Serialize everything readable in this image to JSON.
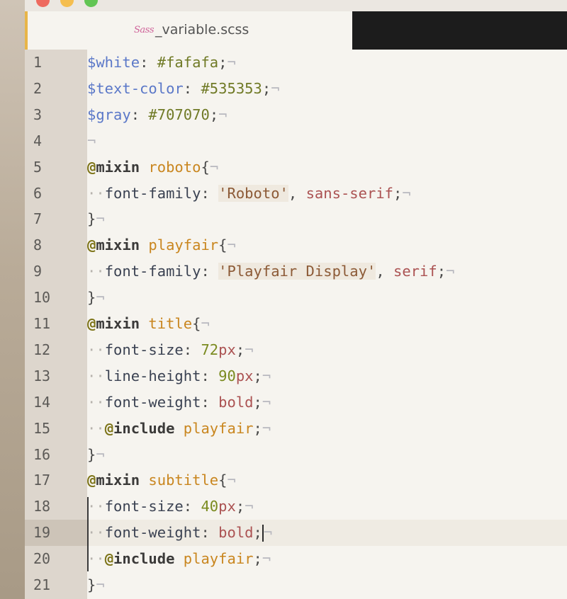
{
  "tab": {
    "filename": "_variable.scss",
    "icon": "sass-icon",
    "accent": "#e8b548"
  },
  "colors": {
    "gutter": "#ddd6cd",
    "editor_bg": "#f6f4ef",
    "tabbar_bg": "#1c1c1c"
  },
  "editor": {
    "current_line": 19
  },
  "lines": [
    {
      "n": "1",
      "indent": "",
      "parts": [
        [
          "var",
          "$white"
        ],
        [
          "punct",
          ": "
        ],
        [
          "hex",
          "#fafafa"
        ],
        [
          "punct",
          ";"
        ],
        [
          "inv",
          "¬"
        ]
      ]
    },
    {
      "n": "2",
      "indent": "",
      "parts": [
        [
          "var",
          "$text-color"
        ],
        [
          "punct",
          ": "
        ],
        [
          "hex",
          "#535353"
        ],
        [
          "punct",
          ";"
        ],
        [
          "inv",
          "¬"
        ]
      ]
    },
    {
      "n": "3",
      "indent": "",
      "parts": [
        [
          "var",
          "$gray"
        ],
        [
          "punct",
          ": "
        ],
        [
          "hex",
          "#707070"
        ],
        [
          "punct",
          ";"
        ],
        [
          "inv",
          "¬"
        ]
      ]
    },
    {
      "n": "4",
      "indent": "",
      "parts": [
        [
          "inv",
          "¬"
        ]
      ]
    },
    {
      "n": "5",
      "indent": "",
      "parts": [
        [
          "at",
          "@"
        ],
        [
          "kw",
          "mixin"
        ],
        [
          "punct",
          " "
        ],
        [
          "mixname",
          "roboto"
        ],
        [
          "punct",
          "{"
        ],
        [
          "inv",
          "¬"
        ]
      ]
    },
    {
      "n": "6",
      "indent": "··",
      "parts": [
        [
          "prop",
          "font-family"
        ],
        [
          "punct",
          ": "
        ],
        [
          "str",
          "'Roboto'"
        ],
        [
          "punct",
          ", "
        ],
        [
          "val",
          "sans-serif"
        ],
        [
          "punct",
          ";"
        ],
        [
          "inv",
          "¬"
        ]
      ]
    },
    {
      "n": "7",
      "indent": "",
      "parts": [
        [
          "punct",
          "}"
        ],
        [
          "inv",
          "¬"
        ]
      ]
    },
    {
      "n": "8",
      "indent": "",
      "parts": [
        [
          "at",
          "@"
        ],
        [
          "kw",
          "mixin"
        ],
        [
          "punct",
          " "
        ],
        [
          "mixname",
          "playfair"
        ],
        [
          "punct",
          "{"
        ],
        [
          "inv",
          "¬"
        ]
      ]
    },
    {
      "n": "9",
      "indent": "··",
      "parts": [
        [
          "prop",
          "font-family"
        ],
        [
          "punct",
          ": "
        ],
        [
          "str",
          "'Playfair Display'"
        ],
        [
          "punct",
          ", "
        ],
        [
          "val",
          "serif"
        ],
        [
          "punct",
          ";"
        ],
        [
          "inv",
          "¬"
        ]
      ]
    },
    {
      "n": "10",
      "indent": "",
      "parts": [
        [
          "punct",
          "}"
        ],
        [
          "inv",
          "¬"
        ]
      ]
    },
    {
      "n": "11",
      "indent": "",
      "parts": [
        [
          "at",
          "@"
        ],
        [
          "kw",
          "mixin"
        ],
        [
          "punct",
          " "
        ],
        [
          "mixname",
          "title"
        ],
        [
          "punct",
          "{"
        ],
        [
          "inv",
          "¬"
        ]
      ]
    },
    {
      "n": "12",
      "indent": "··",
      "parts": [
        [
          "prop",
          "font-size"
        ],
        [
          "punct",
          ": "
        ],
        [
          "num",
          "72"
        ],
        [
          "unit",
          "px"
        ],
        [
          "punct",
          ";"
        ],
        [
          "inv",
          "¬"
        ]
      ]
    },
    {
      "n": "13",
      "indent": "··",
      "parts": [
        [
          "prop",
          "line-height"
        ],
        [
          "punct",
          ": "
        ],
        [
          "num",
          "90"
        ],
        [
          "unit",
          "px"
        ],
        [
          "punct",
          ";"
        ],
        [
          "inv",
          "¬"
        ]
      ]
    },
    {
      "n": "14",
      "indent": "··",
      "parts": [
        [
          "prop",
          "font-weight"
        ],
        [
          "punct",
          ": "
        ],
        [
          "val",
          "bold"
        ],
        [
          "punct",
          ";"
        ],
        [
          "inv",
          "¬"
        ]
      ]
    },
    {
      "n": "15",
      "indent": "··",
      "parts": [
        [
          "at",
          "@"
        ],
        [
          "kw",
          "include"
        ],
        [
          "punct",
          " "
        ],
        [
          "mixname",
          "playfair"
        ],
        [
          "punct",
          ";"
        ],
        [
          "inv",
          "¬"
        ]
      ]
    },
    {
      "n": "16",
      "indent": "",
      "parts": [
        [
          "punct",
          "}"
        ],
        [
          "inv",
          "¬"
        ]
      ]
    },
    {
      "n": "17",
      "indent": "",
      "parts": [
        [
          "at",
          "@"
        ],
        [
          "kw",
          "mixin"
        ],
        [
          "punct",
          " "
        ],
        [
          "mixname",
          "subtitle"
        ],
        [
          "punct",
          "{"
        ],
        [
          "inv",
          "¬"
        ]
      ]
    },
    {
      "n": "18",
      "indent": "··",
      "parts": [
        [
          "prop",
          "font-size"
        ],
        [
          "punct",
          ": "
        ],
        [
          "num",
          "40"
        ],
        [
          "unit",
          "px"
        ],
        [
          "punct",
          ";"
        ],
        [
          "inv",
          "¬"
        ]
      ]
    },
    {
      "n": "19",
      "indent": "··",
      "parts": [
        [
          "prop",
          "font-weight"
        ],
        [
          "punct",
          ": "
        ],
        [
          "val",
          "bold"
        ],
        [
          "punct",
          ";"
        ],
        [
          "caret",
          ""
        ],
        [
          "inv",
          "¬"
        ]
      ]
    },
    {
      "n": "20",
      "indent": "··",
      "parts": [
        [
          "at",
          "@"
        ],
        [
          "kw",
          "include"
        ],
        [
          "punct",
          " "
        ],
        [
          "mixname",
          "playfair"
        ],
        [
          "punct",
          ";"
        ],
        [
          "inv",
          "¬"
        ]
      ]
    },
    {
      "n": "21",
      "indent": "",
      "parts": [
        [
          "punct",
          "}"
        ],
        [
          "inv",
          "¬"
        ]
      ]
    }
  ]
}
